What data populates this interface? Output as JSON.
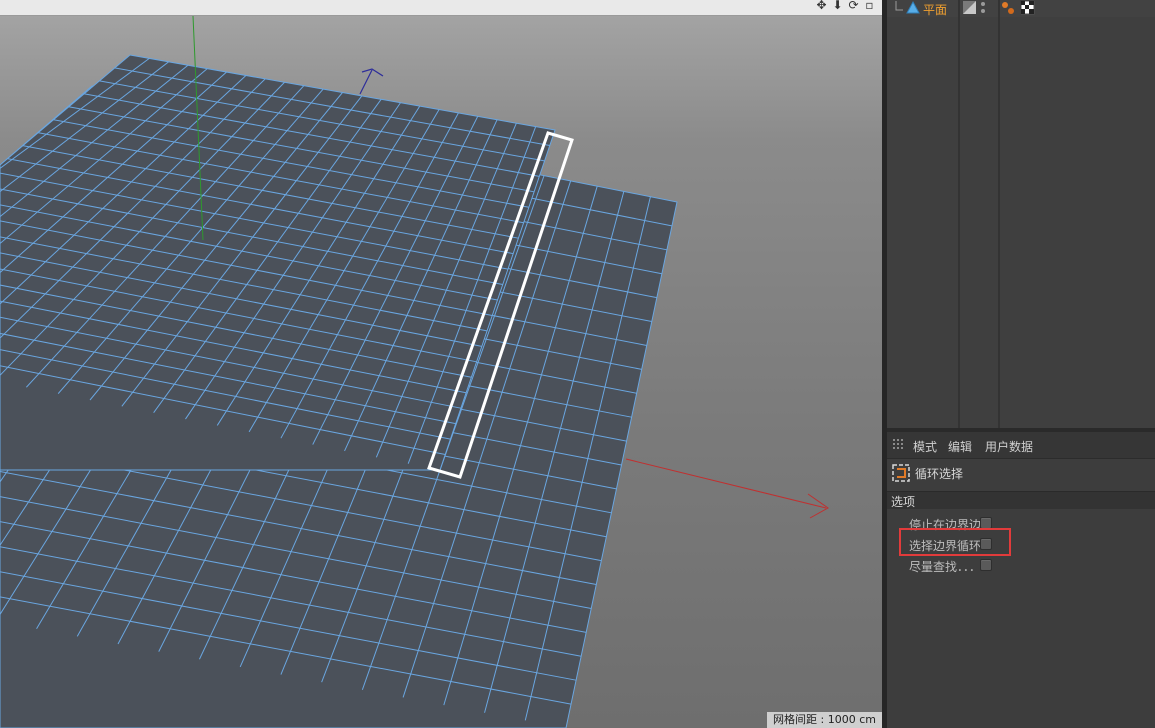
{
  "object_manager": {
    "object_name": "平面"
  },
  "attributes": {
    "tabs": [
      "模式",
      "编辑",
      "用户数据"
    ],
    "tool_title": "循环选择",
    "options_header": "选项",
    "options": [
      {
        "label": "停止在边界边",
        "checked": false
      },
      {
        "label": "选择边界循环",
        "checked": false
      },
      {
        "label": "尽量查找．．．",
        "checked": false
      }
    ]
  },
  "viewport": {
    "grid_spacing": "网格间距 : 1000 cm",
    "nav_icons": [
      "move-view-icon",
      "zoom-view-icon",
      "rotate-view-icon",
      "maximize-view-icon"
    ]
  },
  "colors": {
    "plane_fill": "#4b515a",
    "wire": "#6aa6e0",
    "selection": "#ffffff",
    "highlight": "#e23b3b",
    "object_name": "#f0a030"
  }
}
